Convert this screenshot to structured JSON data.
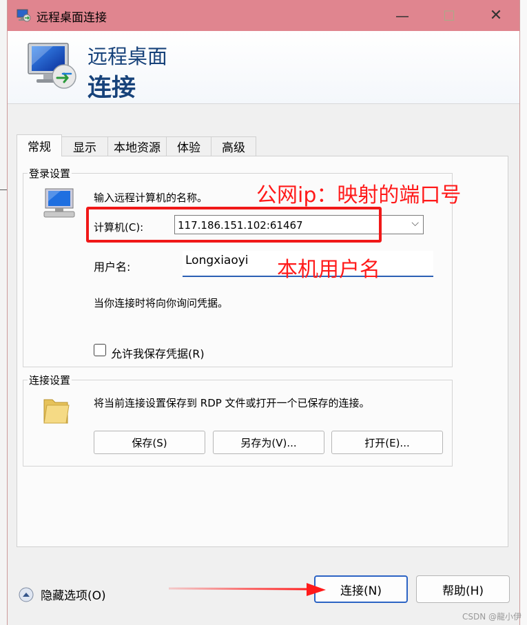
{
  "window": {
    "title": "远程桌面连接",
    "minimize_glyph": "—",
    "maximize_glyph": "☐",
    "close_glyph": "✕"
  },
  "banner": {
    "line1": "远程桌面",
    "line2": "连接"
  },
  "tabs": [
    {
      "label": "常规",
      "active": true
    },
    {
      "label": "显示"
    },
    {
      "label": "本地资源"
    },
    {
      "label": "体验"
    },
    {
      "label": "高级"
    }
  ],
  "login": {
    "group_title": "登录设置",
    "prompt": "输入远程计算机的名称。",
    "computer_label": "计算机(C):",
    "computer_value": "117.186.151.102:61467",
    "username_label": "用户名:",
    "username_value": "Longxiaoyi",
    "credentials_note": "当你连接时将向你询问凭据。",
    "save_credentials_label": "允许我保存凭据(R)",
    "save_credentials_checked": false
  },
  "connection": {
    "group_title": "连接设置",
    "description": "将当前连接设置保存到 RDP 文件或打开一个已保存的连接。",
    "save_label": "保存(S)",
    "save_as_label": "另存为(V)...",
    "open_label": "打开(E)..."
  },
  "footer": {
    "hide_options_label": "隐藏选项(O)",
    "connect_label": "连接(N)",
    "help_label": "帮助(H)"
  },
  "annotations": {
    "ip_note": "公网ip：映射的端口号",
    "user_note": "本机用户名",
    "color": "#ff1a1a"
  },
  "watermark": "CSDN @龍小伊",
  "icons": {
    "title": "remote-desktop-icon",
    "banner": "remote-desktop-monitor-icon",
    "computer": "computer-icon",
    "folder": "folder-icon",
    "hide": "chevron-up-icon"
  }
}
